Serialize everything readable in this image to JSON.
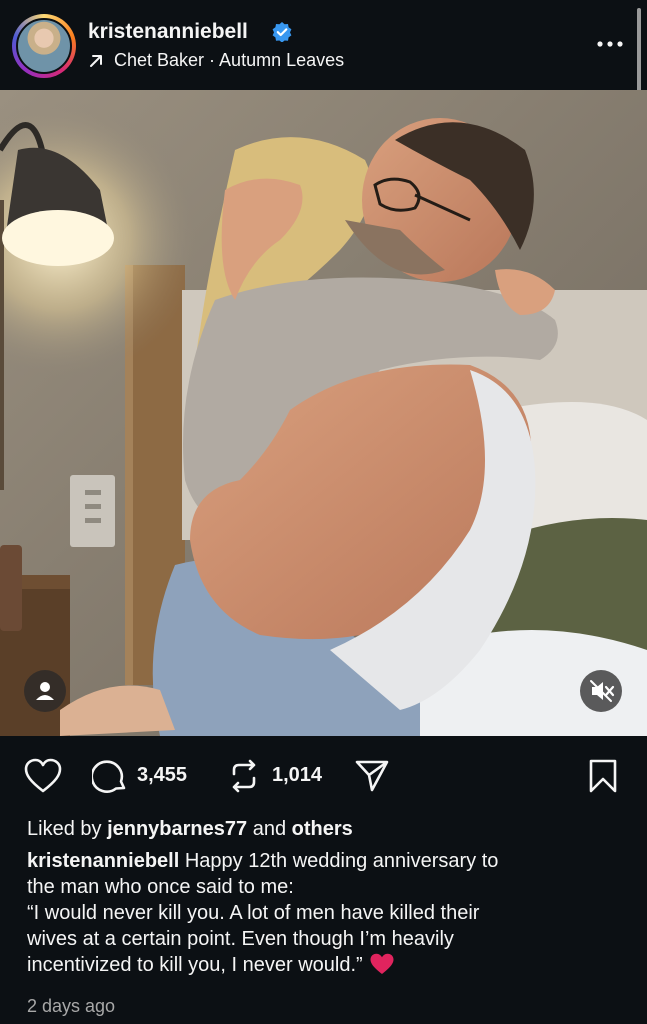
{
  "header": {
    "username": "kristenanniebell",
    "music": "Chet Baker · Autumn Leaves"
  },
  "icons": {
    "verified": "verified-badge-icon",
    "music": "arrow-up-right-icon",
    "more": "more-horizontal-icon",
    "user_tag": "user-tag-icon",
    "mute": "muted-speaker-icon",
    "like": "heart-outline-icon",
    "comment": "comment-bubble-icon",
    "repost": "repost-icon",
    "share": "send-icon",
    "save": "bookmark-icon"
  },
  "actions": {
    "comments": "3,455",
    "reposts": "1,014"
  },
  "likes": {
    "prefix": "Liked by",
    "user": "jennybarnes77",
    "middle": "and",
    "suffix": "others"
  },
  "caption": {
    "author": "kristenanniebell",
    "line1": "Happy 12th wedding anniversary to",
    "line2": "the man who once said to me:",
    "line3": "“I would never kill you. A lot of men have killed their",
    "line4": "wives at a certain point. Even though I’m heavily",
    "line5": "incentivized to kill you, I never would.”"
  },
  "timestamp": "2 days ago",
  "colors": {
    "background": "#0c1014",
    "verified": "#3897f0",
    "heart": "#e0245e"
  }
}
